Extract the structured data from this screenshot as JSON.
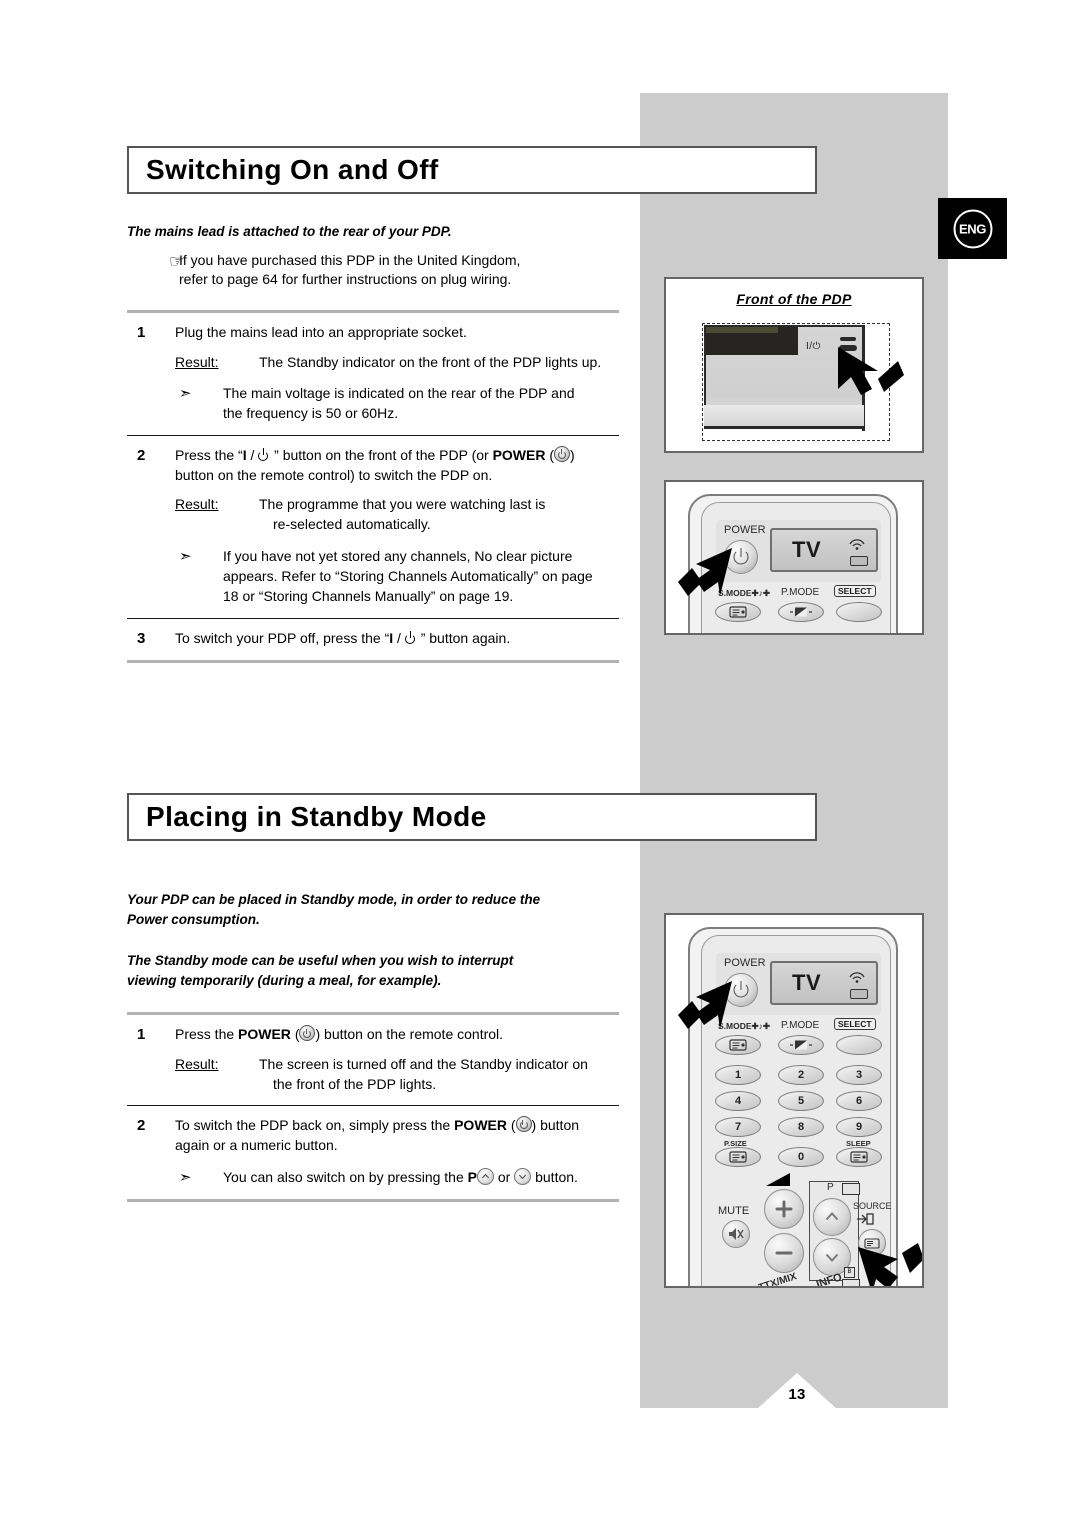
{
  "page": {
    "number": "13",
    "language_badge": "ENG"
  },
  "sections": [
    {
      "id": "switching",
      "title": "Switching On and Off",
      "intro": "The mains lead is attached to the rear of your PDP.",
      "note_glyph": "pointing-hand",
      "note_lines": [
        "If you have purchased this PDP in the United Kingdom,",
        "refer to page 64 for further instructions on plug wiring."
      ],
      "steps": [
        {
          "num": "1",
          "lines": [
            "Plug the mains lead into an appropriate socket."
          ],
          "result_label": "Result:",
          "result_lines": [
            "The Standby indicator on the front of the PDP lights up."
          ],
          "bullet_lines": [
            "The main voltage is indicated on the rear of the PDP and",
            "the frequency is 50 or 60Hz."
          ]
        },
        {
          "num": "2",
          "lines": [
            "Press the “ I / ⏻ ” button on the front of the PDP (or POWER (◎)",
            "button on the remote control) to switch the PDP on."
          ],
          "result_label": "Result:",
          "result_lines": [
            "The programme that you were watching last is",
            "re-selected automatically."
          ],
          "bullet_lines": [
            "If you have not yet stored any channels, No clear picture",
            "appears. Refer to “Storing Channels Automatically” on page",
            "18 or “Storing Channels Manually” on page 19."
          ]
        },
        {
          "num": "3",
          "lines": [
            "To switch your PDP off, press the “ I / ⏻ ” button again."
          ],
          "result_label": "",
          "result_lines": [],
          "bullet_lines": []
        }
      ]
    },
    {
      "id": "standby",
      "title": "Placing in Standby Mode",
      "intro_paragraphs": [
        [
          "Your PDP can be placed in Standby mode, in order to reduce the",
          "Power consumption."
        ],
        [
          "The Standby mode can be useful when you wish to interrupt",
          "viewing temporarily (during a meal, for example)."
        ]
      ],
      "steps": [
        {
          "num": "1",
          "lines": [
            "Press the POWER (◎) button on the remote control."
          ],
          "result_label": "Result:",
          "result_lines": [
            "The screen is turned off and the Standby indicator on",
            "the front of the PDP lights."
          ],
          "bullet_lines": []
        },
        {
          "num": "2",
          "lines": [
            "To switch the PDP back on, simply press the POWER (◎) button",
            "again or a numeric button."
          ],
          "result_label": "",
          "result_lines": [],
          "bullet_lines": [
            "You can also switch on by pressing the P⌃ or ⌄ button."
          ]
        }
      ]
    }
  ],
  "text_fragments": {
    "step2_a": "Press the “",
    "step2_io": "I",
    "step2_slash": " / ",
    "step2_b": " ” button on the front of the PDP (or ",
    "step2_power": "POWER",
    "step2_c": ")",
    "step2_line2": "button on the remote control) to switch the PDP on.",
    "step3_a": "To switch your PDP off, press the “",
    "step3_b": " ” button again.",
    "sb_step1_a": "Press the ",
    "sb_step1_power": "POWER",
    "sb_step1_b": ") button on the remote control.",
    "sb_step2_a": "To switch the PDP back on, simply press the ",
    "sb_step2_power": "POWER",
    "sb_step2_b": ") button",
    "sb_step2_line2": "again or a numeric button.",
    "sb_bullet_a": "You can also switch on by pressing the ",
    "sb_bullet_p": "P",
    "sb_bullet_or": " or ",
    "sb_bullet_end": " button.",
    "open_paren": "("
  },
  "illustrations": {
    "front_pdp": {
      "caption": "Front of the PDP",
      "io_label": "I/⏻"
    },
    "remote_top": {
      "power_label": "POWER",
      "display_text": "TV",
      "smode_label": "S.MODE",
      "pmode_label": "P.MODE",
      "select_label": "SELECT"
    },
    "remote_big": {
      "power_label": "POWER",
      "display_text": "TV",
      "smode_label": "S.MODE",
      "pmode_label": "P.MODE",
      "select_label": "SELECT",
      "numeric_keys": [
        "1",
        "2",
        "3",
        "4",
        "5",
        "6",
        "7",
        "8",
        "9",
        "0"
      ],
      "psize_label": "P.SIZE",
      "sleep_label": "SLEEP",
      "mute_label": "MUTE",
      "p_label": "P",
      "source_label": "SOURCE",
      "ttxmix_label": "TTX/MIX",
      "info_label": "INFO"
    }
  },
  "colors": {
    "gray_panel": "#cccccc",
    "title_border": "#555555",
    "badge_bg": "#000000",
    "rule_thick": "#b3b3b3",
    "rule_thin": "#1a1a1a"
  }
}
